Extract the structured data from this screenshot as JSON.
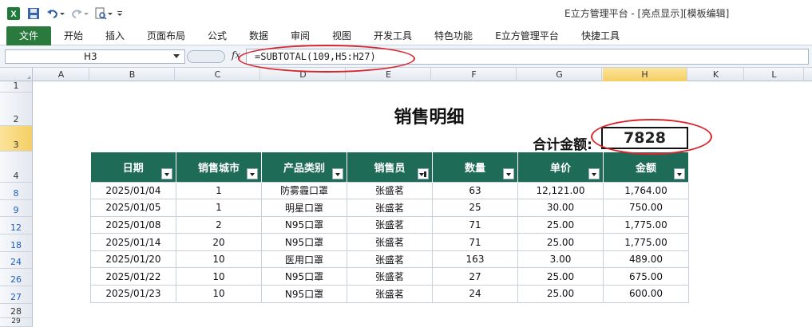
{
  "window": {
    "title": "E立方管理平台  -  [亮点显示][模板编辑]"
  },
  "ribbon": {
    "tabs": [
      "文件",
      "开始",
      "插入",
      "页面布局",
      "公式",
      "数据",
      "审阅",
      "视图",
      "开发工具",
      "特色功能",
      "E立方管理平台",
      "快捷工具"
    ]
  },
  "formula_bar": {
    "name_box": "H3",
    "fx_label": "fx",
    "formula": "=SUBTOTAL(109,H5:H27)"
  },
  "columns": [
    "A",
    "B",
    "C",
    "D",
    "E",
    "F",
    "G",
    "H",
    "K",
    "L"
  ],
  "selected_column": "H",
  "rows": [
    "1",
    "2",
    "3",
    "4",
    "8",
    "9",
    "12",
    "18",
    "24",
    "26",
    "27",
    "28",
    "29"
  ],
  "selected_row": "3",
  "sheet": {
    "title": "销售明细",
    "total_label": "合计金额:",
    "total_value": "7828"
  },
  "table": {
    "headers": [
      "日期",
      "销售城市",
      "产品类别",
      "销售员",
      "数量",
      "单价",
      "金额"
    ],
    "filtered_column": "销售员",
    "rows": [
      [
        "2025/01/04",
        "1",
        "防雾霾口罩",
        "张盛茗",
        "63",
        "12,121.00",
        "1,764.00"
      ],
      [
        "2025/01/05",
        "1",
        "明星口罩",
        "张盛茗",
        "25",
        "30.00",
        "750.00"
      ],
      [
        "2025/01/08",
        "2",
        "N95口罩",
        "张盛茗",
        "71",
        "25.00",
        "1,775.00"
      ],
      [
        "2025/01/14",
        "20",
        "N95口罩",
        "张盛茗",
        "71",
        "25.00",
        "1,775.00"
      ],
      [
        "2025/01/20",
        "10",
        "医用口罩",
        "张盛茗",
        "163",
        "3.00",
        "489.00"
      ],
      [
        "2025/01/22",
        "10",
        "N95口罩",
        "张盛茗",
        "27",
        "25.00",
        "675.00"
      ],
      [
        "2025/01/23",
        "10",
        "N95口罩",
        "张盛茗",
        "24",
        "25.00",
        "600.00"
      ]
    ]
  },
  "colors": {
    "header_bg": "#1e6b57",
    "file_tab": "#2a7a3d",
    "annotation": "#d9262e",
    "selected_header": "#f5cf63"
  },
  "icons": [
    "excel-icon",
    "save-icon",
    "undo-icon",
    "redo-icon",
    "print-preview-icon",
    "customize-quick-access-icon",
    "filter-dropdown-icon",
    "filter-active-icon"
  ]
}
